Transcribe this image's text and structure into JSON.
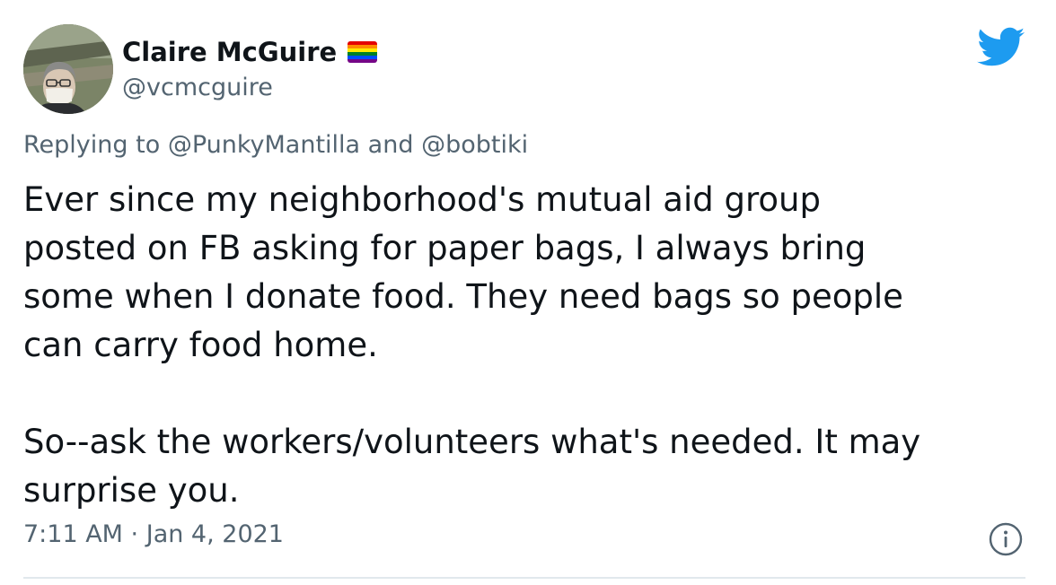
{
  "author": {
    "display_name": "Claire McGuire",
    "handle": "@vcmcguire",
    "avatar_icon": "user-avatar-photo",
    "name_badge_icon": "rainbow-flag-icon"
  },
  "brand": {
    "icon": "twitter-bird-icon",
    "color": "#1d9bf0"
  },
  "reply": {
    "prefix": "Replying to ",
    "mention_1": "@PunkyMantilla",
    "joiner": " and ",
    "mention_2": "@bobtiki"
  },
  "tweet": {
    "paragraph_1": "Ever since my neighborhood's mutual aid group\nposted on FB asking for paper bags, I always bring\nsome when I donate food. They need bags so people\ncan carry food home.",
    "paragraph_2": "So--ask the workers/volunteers what's needed. It may\nsurprise you.",
    "timestamp": "7:11 AM · Jan 4, 2021"
  },
  "info": {
    "icon": "info-icon"
  },
  "colors": {
    "text_primary": "#0f1419",
    "text_secondary": "#536471",
    "divider": "#e1e8ed"
  }
}
